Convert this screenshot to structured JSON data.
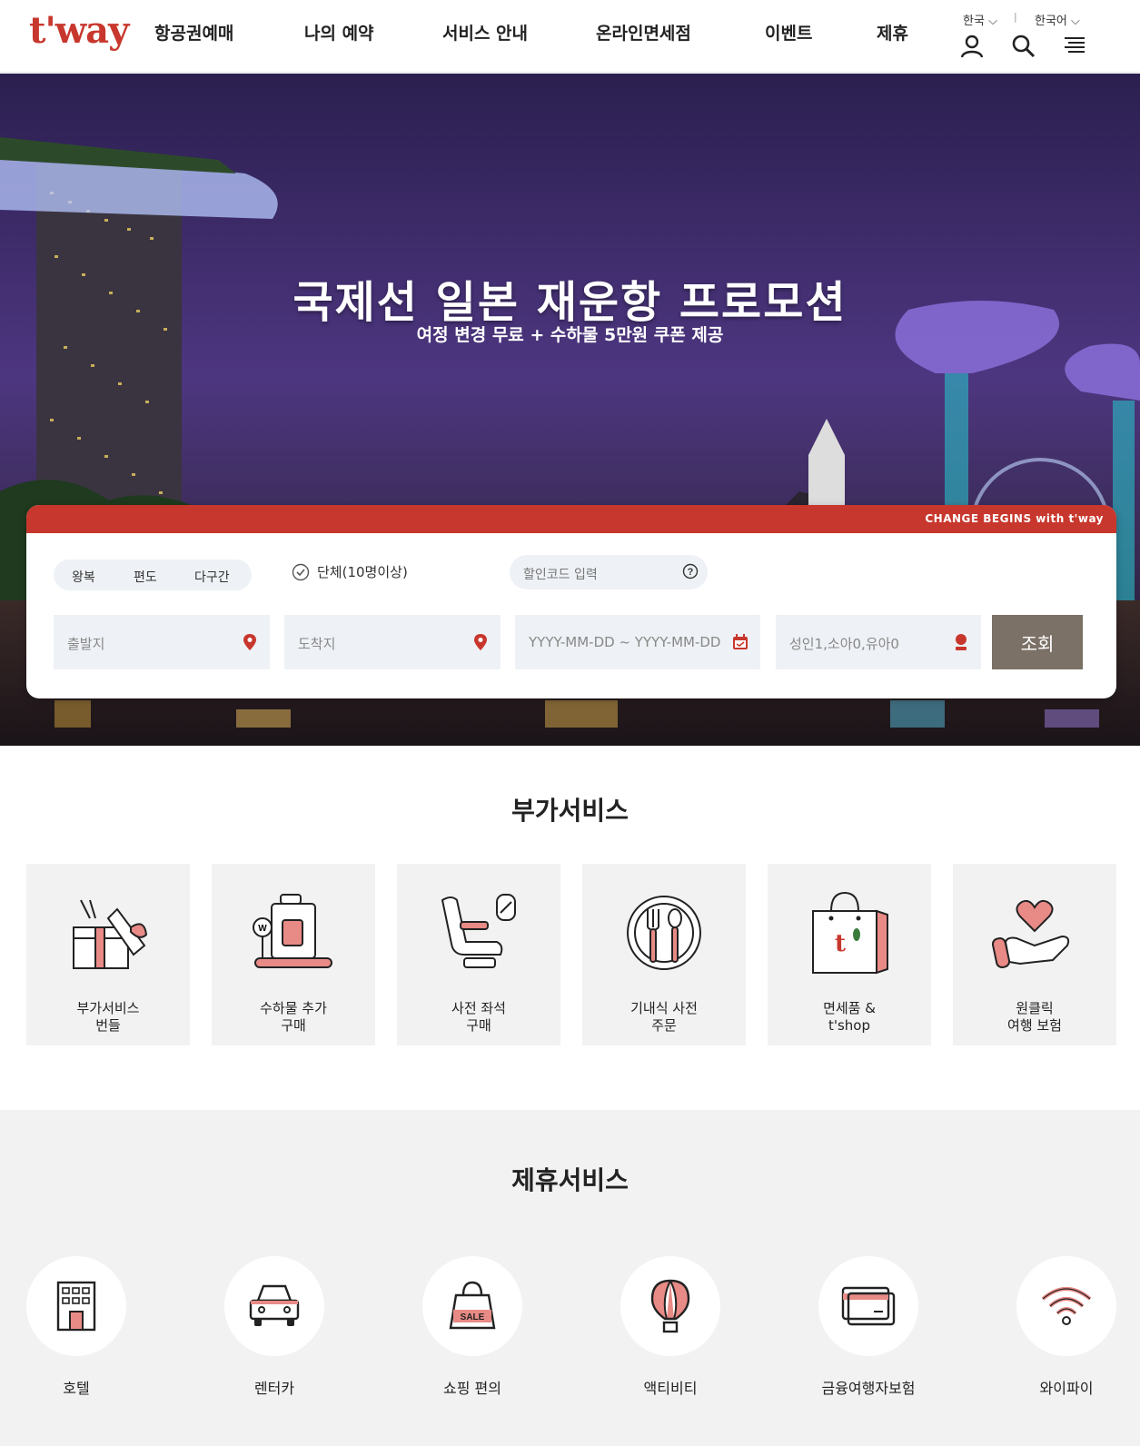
{
  "header": {
    "logo": "t'way",
    "nav": [
      "항공권예매",
      "나의 예약",
      "서비스 안내",
      "온라인면세점",
      "이벤트",
      "제휴"
    ],
    "country": "한국",
    "language": "한국어",
    "separator": "|"
  },
  "hero": {
    "title": "국제선 일본 재운항 프로모션",
    "subtitle": "여정 변경 무료 + 수하물 5만원 쿠폰 제공"
  },
  "booking": {
    "bar_text": "CHANGE BEGINS with t'way",
    "trip_types": [
      "왕복",
      "편도",
      "다구간"
    ],
    "group_label": "단체(10명이상)",
    "promo_placeholder": "할인코드 입력",
    "from_placeholder": "출발지",
    "to_placeholder": "도착지",
    "date_placeholder": "YYYY-MM-DD  ~  YYYY-MM-DD",
    "pax_placeholder": "성인1,소아0,유아0",
    "search_label": "조회"
  },
  "addon": {
    "title": "부가서비스",
    "items": [
      {
        "line1": "부가서비스",
        "line2": "번들",
        "icon": "gift-box-icon"
      },
      {
        "line1": "수하물 추가",
        "line2": "구매",
        "icon": "luggage-icon"
      },
      {
        "line1": "사전 좌석",
        "line2": "구매",
        "icon": "seat-icon"
      },
      {
        "line1": "기내식 사전",
        "line2": "주문",
        "icon": "meal-icon"
      },
      {
        "line1": "면세품 &",
        "line2": "t'shop",
        "icon": "shopping-bag-icon"
      },
      {
        "line1": "원클릭",
        "line2": "여행 보험",
        "icon": "heart-hand-icon"
      }
    ]
  },
  "partner": {
    "title": "제휴서비스",
    "items": [
      {
        "label": "호텔",
        "icon": "hotel-icon"
      },
      {
        "label": "렌터카",
        "icon": "car-icon"
      },
      {
        "label": "쇼핑 편의",
        "icon": "sale-bag-icon"
      },
      {
        "label": "액티비티",
        "icon": "balloon-icon"
      },
      {
        "label": "금융여행자보험",
        "icon": "card-icon"
      },
      {
        "label": "와이파이",
        "icon": "wifi-icon"
      }
    ],
    "sale_text": "SALE"
  },
  "colors": {
    "brand": "#c8372d",
    "button": "#7c7167",
    "panel_bg": "#f2f2f2"
  }
}
